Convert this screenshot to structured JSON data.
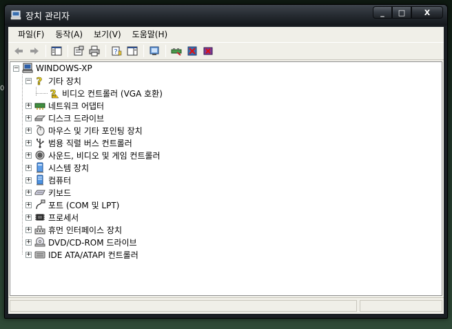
{
  "window": {
    "title": "장치 관리자"
  },
  "desktop": {
    "glyph": "어"
  },
  "menu": [
    {
      "label": "파일(F)"
    },
    {
      "label": "동작(A)"
    },
    {
      "label": "보기(V)"
    },
    {
      "label": "도움말(H)"
    }
  ],
  "toolbar": {
    "icons": [
      "back-arrow-icon",
      "forward-arrow-icon",
      "console-tree-icon",
      "properties-icon",
      "print-icon",
      "help-icon",
      "action-pane-icon",
      "scan-hardware-icon",
      "update-driver-icon",
      "disable-device-icon",
      "uninstall-device-icon"
    ]
  },
  "tree": {
    "root": "WINDOWS-XP",
    "other_devices": "기타 장치",
    "video_controller": "비디오 컨트롤러 (VGA 호환)",
    "network_adapters": "네트워크 어댑터",
    "disk_drives": "디스크 드라이브",
    "mice": "마우스 및 기타 포인팅 장치",
    "usb": "범용 직렬 버스 컨트롤러",
    "sound": "사운드, 비디오 및 게임 컨트롤러",
    "system": "시스템 장치",
    "computer": "컴퓨터",
    "keyboard": "키보드",
    "ports": "포트 (COM 및 LPT)",
    "processor": "프로세서",
    "hid": "휴먼 인터페이스 장치",
    "dvd": "DVD/CD-ROM 드라이브",
    "ide": "IDE ATA/ATAPI 컨트롤러"
  },
  "caption": {
    "minimize": "_",
    "maximize": "□",
    "close": "X"
  },
  "tree_expand_symbols": {
    "expanded": "−",
    "collapsed": "+"
  }
}
